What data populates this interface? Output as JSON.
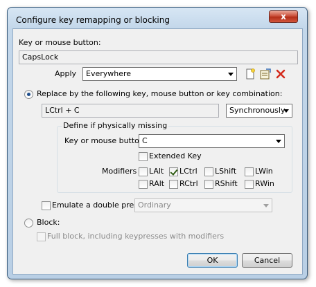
{
  "dialog": {
    "title": "Configure key remapping or blocking",
    "close_glyph": "x"
  },
  "key_section": {
    "label": "Key or mouse button:",
    "value": "CapsLock"
  },
  "apply": {
    "label": "Apply",
    "selected": "Everywhere",
    "icons": [
      "new-document-icon",
      "edit-properties-icon",
      "delete-red-x-icon"
    ]
  },
  "replace": {
    "radio_label": "Replace by the following key, mouse button or key combination:",
    "checked": true,
    "combination_value": "LCtrl + C",
    "mode_selected": "Synchronously"
  },
  "physical_group": {
    "title": "Define if physically missing",
    "key_label": "Key or mouse button",
    "key_selected": "C",
    "extended_key": {
      "label": "Extended Key",
      "checked": false
    },
    "modifiers_label": "Modifiers",
    "modifiers": [
      {
        "label": "LAlt",
        "checked": false
      },
      {
        "label": "LCtrl",
        "checked": true
      },
      {
        "label": "LShift",
        "checked": false
      },
      {
        "label": "LWin",
        "checked": false
      },
      {
        "label": "RAlt",
        "checked": false
      },
      {
        "label": "RCtrl",
        "checked": false
      },
      {
        "label": "RShift",
        "checked": false
      },
      {
        "label": "RWin",
        "checked": false
      }
    ]
  },
  "double_press": {
    "label": "Emulate a double press:",
    "checked": false,
    "selected": "Ordinary"
  },
  "block": {
    "radio_label": "Block:",
    "checked": false,
    "full_block_label": "Full block, including keypresses with modifiers",
    "full_block_checked": false
  },
  "buttons": {
    "ok": "OK",
    "cancel": "Cancel"
  },
  "colors": {
    "title_bar": "#c3d7ea",
    "client_bg": "#f0f0f0",
    "close_button": "#c7452f",
    "check_mark": "#2e5c12"
  }
}
